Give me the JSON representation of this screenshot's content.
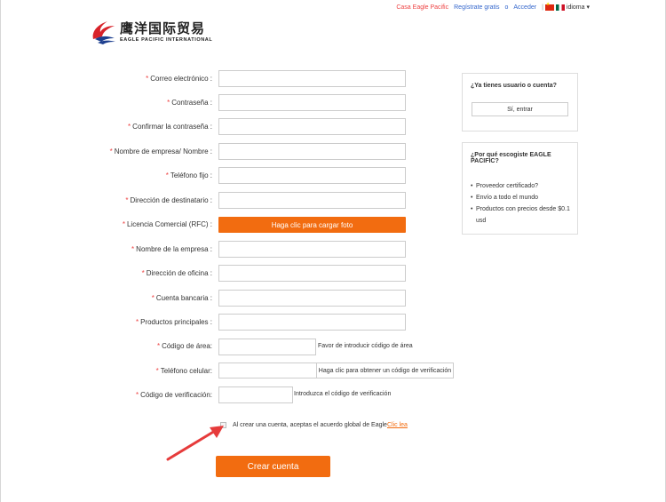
{
  "topbar": {
    "home": "Casa Eagle Pacific",
    "register": "Regístrate gratis",
    "or": "o",
    "login": "Acceder",
    "separator": "|",
    "language": "idioma ▾"
  },
  "logo": {
    "cn": "鹰洋国际贸易",
    "en": "EAGLE PACIFIC INTERNATIONAL"
  },
  "form": {
    "required_mark": "*",
    "email_label": "Correo electrónico :",
    "password_label": "Contraseña :",
    "confirm_password_label": "Confirmar la contraseña :",
    "company_name_person_label": "Nombre de empresa/ Nombre :",
    "landline_label": "Teléfono fijo :",
    "destination_address_label": "Dirección de destinatario :",
    "license_label": "Licencia Comercial (RFC) :",
    "upload_button": "Haga clic para cargar foto",
    "company_label": "Nombre de la empresa :",
    "office_address_label": "Dirección de oficina :",
    "bank_account_label": "Cuenta bancaria :",
    "main_products_label": "Productos principales :",
    "area_code_label": "Código de área:",
    "area_code_hint": "Favor de introducir código de área",
    "mobile_label": "Teléfono celular:",
    "get_code_button": "Haga clic para obtener un código de verificación",
    "verification_label": "Código de verificación:",
    "verification_hint": "Introduzca el código de verificación",
    "agreement_text": "Al crear una cuenta, aceptas el acuerdo global de Eagle",
    "agreement_link": "Clic lea",
    "submit_button": "Crear cuenta"
  },
  "side": {
    "account_title": "¿Ya tienes usuario o cuenta?",
    "enter_button": "Sí, entrar",
    "why_title": "¿Por qué escogiste EAGLE PACIFIC?",
    "reasons": [
      "Proveedor certificado?",
      "Envío a todo el mundo",
      "Productos con precios desde $0.1 usd"
    ]
  },
  "colors": {
    "accent": "#f26c10",
    "required": "#ee4444",
    "link": "#3366cc"
  }
}
